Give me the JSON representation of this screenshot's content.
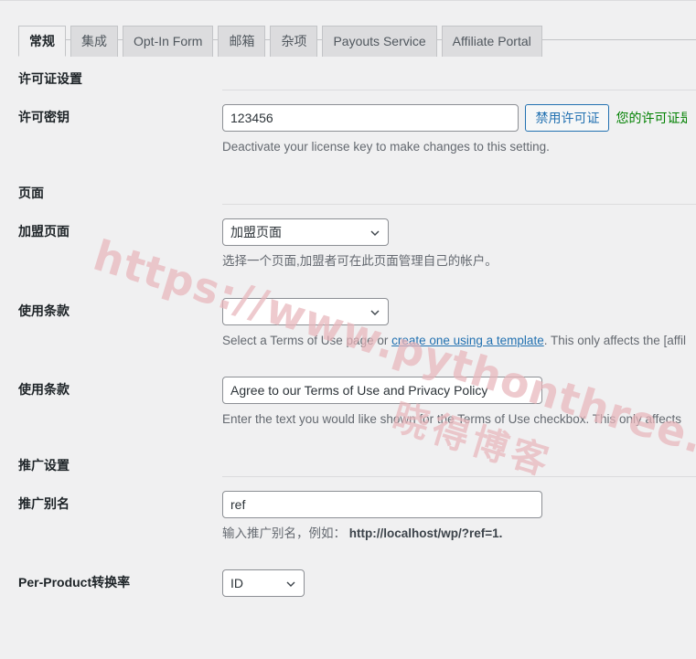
{
  "tabs": [
    {
      "label": "常规",
      "active": true
    },
    {
      "label": "集成",
      "active": false
    },
    {
      "label": "Opt-In Form",
      "active": false
    },
    {
      "label": "邮箱",
      "active": false
    },
    {
      "label": "杂项",
      "active": false
    },
    {
      "label": "Payouts Service",
      "active": false
    },
    {
      "label": "Affiliate Portal",
      "active": false
    }
  ],
  "watermark": {
    "url": "https://www.pythonthree.com",
    "cn": "晓得博客",
    "color": "#e8b6bc"
  },
  "colors": {
    "background": "#f0f0f1",
    "accent": "#2271b1",
    "success": "#008000",
    "border": "#8c8f94",
    "rule": "#dcdcde"
  },
  "sections": {
    "license": {
      "title": "许可证设置"
    },
    "pages": {
      "title": "页面"
    },
    "promotion": {
      "title": "推广设置"
    }
  },
  "fields": {
    "license_key": {
      "label": "许可密钥",
      "value": "123456",
      "placeholder": "",
      "button_label": "禁用许可证",
      "status_text": "您的许可证是",
      "description": "Deactivate your license key to make changes to this setting."
    },
    "affiliate_page": {
      "label": "加盟页面",
      "selected": "加盟页面",
      "description": "选择一个页面,加盟者可在此页面管理自己的帐户。"
    },
    "terms_page": {
      "label": "使用条款",
      "selected": "",
      "description_before": "Select a Terms of Use page or ",
      "description_link": "create one using a template",
      "description_after": ". This only affects the [affil"
    },
    "terms_text": {
      "label": "使用条款",
      "value": "Agree to our Terms of Use and Privacy Policy",
      "description": "Enter the text you would like shown for the Terms of Use checkbox. This only affects"
    },
    "referral_slug": {
      "label": "推广别名",
      "value": "ref",
      "description_before": "输入推广别名，例如：",
      "description_url": "http://localhost/wp/?ref=1."
    },
    "per_product_rate": {
      "label": "Per-Product转换率",
      "selected": "ID"
    }
  }
}
